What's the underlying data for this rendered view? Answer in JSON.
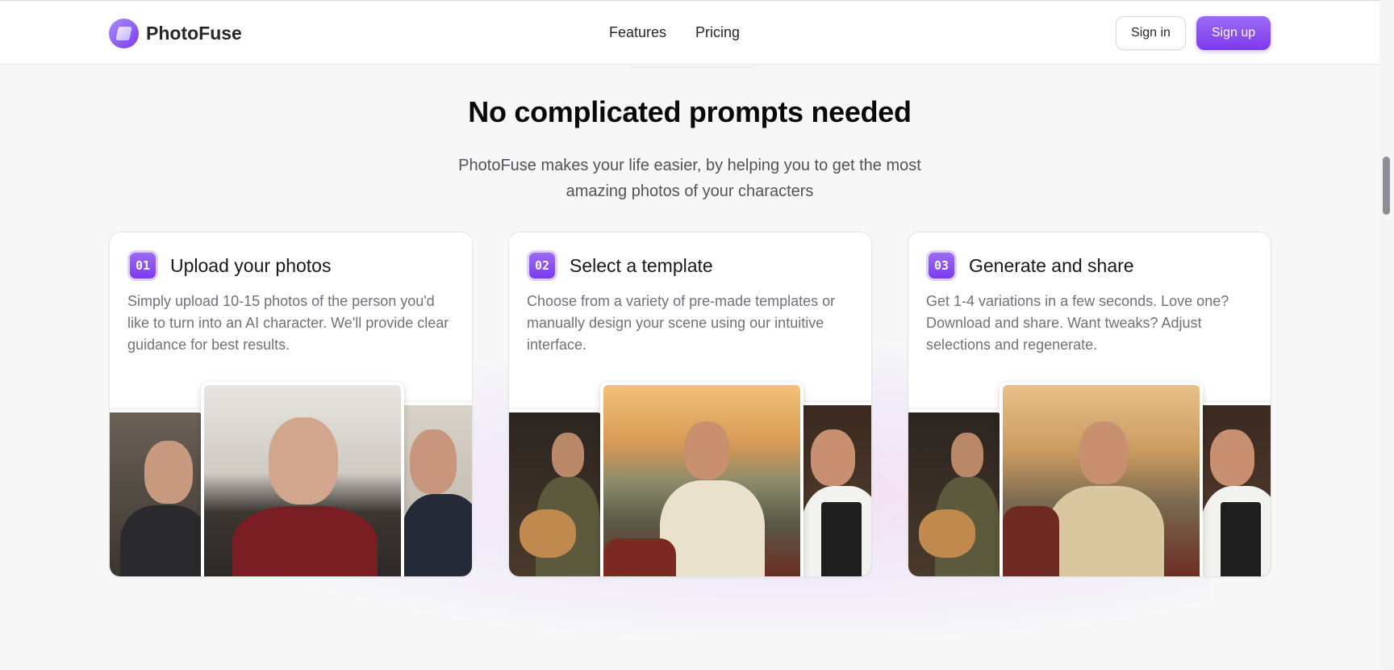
{
  "header": {
    "brand": "PhotoFuse",
    "nav": [
      "Features",
      "Pricing"
    ],
    "signin_label": "Sign in",
    "signup_label": "Sign up"
  },
  "section": {
    "title": "No complicated prompts needed",
    "subtitle": "PhotoFuse makes your life easier, by helping you to get the most amazing photos of your characters"
  },
  "steps": [
    {
      "number": "01",
      "title": "Upload your photos",
      "description": "Simply upload 10-15 photos of the person you'd like to turn into an AI character. We'll provide clear guidance for best results."
    },
    {
      "number": "02",
      "title": "Select a template",
      "description": "Choose from a variety of pre-made templates or manually design your scene using our intuitive interface."
    },
    {
      "number": "03",
      "title": "Generate and share",
      "description": "Get 1-4 variations in a few seconds. Love one? Download and share. Want tweaks? Adjust selections and regenerate."
    }
  ],
  "colors": {
    "accent": "#7c3aed",
    "accent_light": "#9d6bf5",
    "background": "#f7f7f8",
    "text_muted": "#71717a"
  }
}
